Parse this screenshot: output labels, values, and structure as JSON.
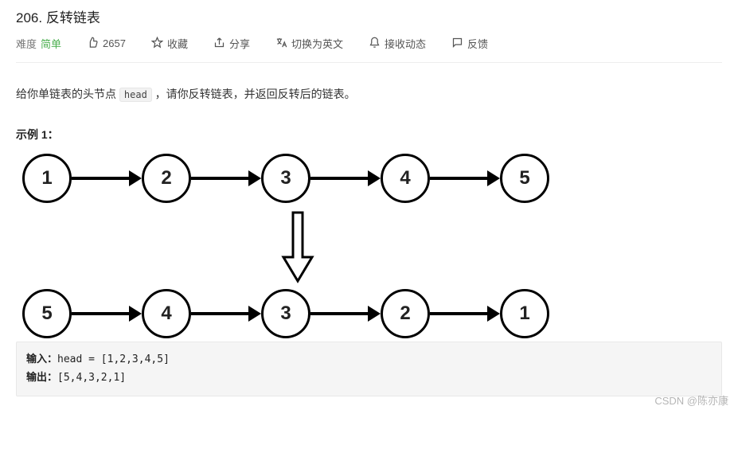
{
  "title": {
    "number": "206.",
    "name": "反转链表"
  },
  "meta": {
    "difficulty_label": "难度",
    "difficulty_value": "简单",
    "likes": "2657",
    "favorite": "收藏",
    "share": "分享",
    "switch_lang": "切换为英文",
    "notify": "接收动态",
    "feedback": "反馈"
  },
  "description": {
    "pre": "给你单链表的头节点 ",
    "code": "head",
    "post": " ，请你反转链表，并返回反转后的链表。"
  },
  "example": {
    "heading": "示例 1：",
    "top_nodes": [
      "1",
      "2",
      "3",
      "4",
      "5"
    ],
    "bottom_nodes": [
      "5",
      "4",
      "3",
      "2",
      "1"
    ],
    "io": {
      "input_label": "输入：",
      "input_value": "head = [1,2,3,4,5]",
      "output_label": "输出：",
      "output_value": "[5,4,3,2,1]"
    }
  },
  "watermark": "CSDN @陈亦康"
}
